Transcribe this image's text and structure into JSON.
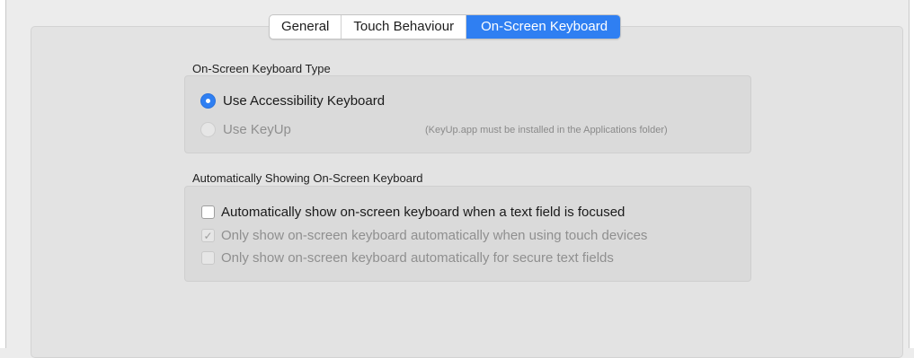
{
  "tabs": [
    {
      "label": "General",
      "selected": false
    },
    {
      "label": "Touch Behaviour",
      "selected": false
    },
    {
      "label": "On-Screen Keyboard",
      "selected": true
    }
  ],
  "keyboard_type": {
    "title": "On-Screen Keyboard Type",
    "options": [
      {
        "label": "Use Accessibility Keyboard",
        "selected": true,
        "enabled": true
      },
      {
        "label": "Use KeyUp",
        "selected": false,
        "enabled": false
      }
    ],
    "keyup_note": "(KeyUp.app must be installed in the Applications folder)"
  },
  "auto_show": {
    "title": "Automatically Showing On-Screen Keyboard",
    "checkboxes": [
      {
        "label": "Automatically show on-screen keyboard when a text field is focused",
        "checked": false,
        "enabled": true
      },
      {
        "label": "Only show on-screen keyboard automatically when using touch devices",
        "checked": true,
        "enabled": false
      },
      {
        "label": "Only show on-screen keyboard automatically for secure text fields",
        "checked": false,
        "enabled": false
      }
    ]
  },
  "colors": {
    "accent": "#2f7ff2",
    "background": "#ececec",
    "group_box": "#dadada"
  }
}
